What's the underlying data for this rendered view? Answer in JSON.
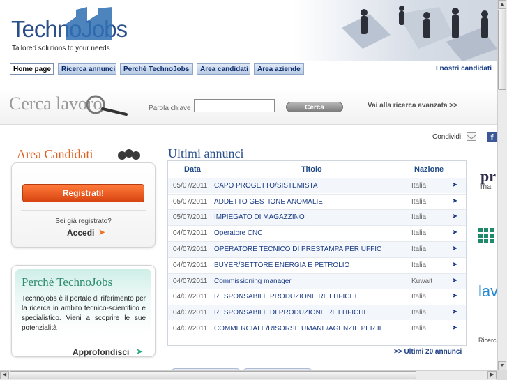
{
  "header": {
    "logo_part1": "Techno",
    "logo_part2": "Jobs",
    "tagline": "Tailored solutions to your needs"
  },
  "nav": {
    "tabs": [
      "Home page",
      "Ricerca annunci",
      "Perchè TechnoJobs",
      "Area candidati",
      "Area aziende"
    ],
    "right_link": "I nostri candidati"
  },
  "search": {
    "title": "Cerca lavoro",
    "keyword_label": "Parola chiave",
    "keyword_value": "",
    "button_label": "Cerca",
    "advanced_link": "Vai alla ricerca avanzata >>"
  },
  "share": {
    "label": "Condividi"
  },
  "candidates": {
    "title": "Area Candidati",
    "register_button": "Registrati!",
    "already_registered": "Sei già registrato?",
    "login_link": "Accedi"
  },
  "why": {
    "title": "Perchè TechnoJobs",
    "text": "Technojobs è il portale di riferimento per la ricerca in ambito tecnico-scientifico e specialistico. Vieni a scoprire le sue potenzialità",
    "more_link": "Approfondisci"
  },
  "listings": {
    "title": "Ultimi annunci",
    "col_date": "Data",
    "col_title": "Titolo",
    "col_country": "Nazione",
    "rows": [
      {
        "date": "05/07/2011",
        "title": "CAPO PROGETTO/SISTEMISTA",
        "country": "Italia"
      },
      {
        "date": "05/07/2011",
        "title": "ADDETTO GESTIONE ANOMALIE",
        "country": "Italia"
      },
      {
        "date": "05/07/2011",
        "title": "IMPIEGATO DI MAGAZZINO",
        "country": "Italia"
      },
      {
        "date": "04/07/2011",
        "title": "Operatore CNC",
        "country": "Italia"
      },
      {
        "date": "04/07/2011",
        "title": "OPERATORE TECNICO DI PRESTAMPA PER UFFIC",
        "country": "Italia"
      },
      {
        "date": "04/07/2011",
        "title": "BUYER/SETTORE ENERGIA E PETROLIO",
        "country": "Italia"
      },
      {
        "date": "04/07/2011",
        "title": "Commissioning manager",
        "country": "Kuwait"
      },
      {
        "date": "04/07/2011",
        "title": "RESPONSABILE PRODUZIONE RETTIFICHE",
        "country": "Italia"
      },
      {
        "date": "04/07/2011",
        "title": "RESPONSABILE DI PRODUZIONE RETTIFICHE",
        "country": "Italia"
      },
      {
        "date": "04/07/2011",
        "title": "COMMERCIALE/RISORSE UMANE/AGENZIE PER IL",
        "country": "Italia"
      }
    ],
    "more_link": ">> Ultimi 20 annunci"
  },
  "partners": {
    "p1_text": "pr",
    "p1_sub": "ma",
    "p3_text": "lav",
    "p4_text": "Ricerca"
  },
  "icons": {
    "arrow": "➤",
    "facebook": "f"
  }
}
